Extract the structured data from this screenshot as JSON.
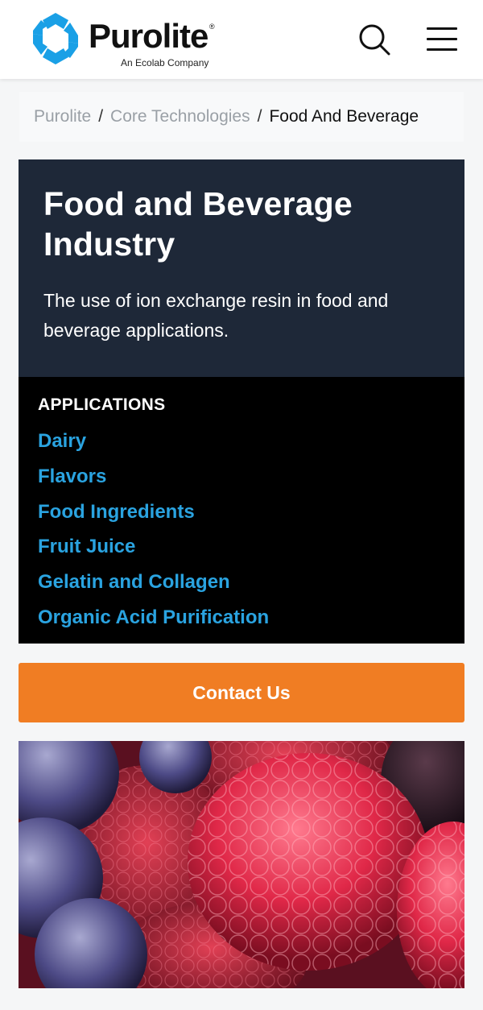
{
  "header": {
    "logo_word": "Purolite",
    "logo_reg": "®",
    "logo_tagline": "An Ecolab Company",
    "logo_color": "#1aa0e6"
  },
  "breadcrumb": {
    "items": [
      "Purolite",
      "Core Technologies"
    ],
    "separator": "/",
    "current": "Food And Beverage"
  },
  "hero": {
    "title": "Food and Beverage Industry",
    "description": "The use of ion exchange resin in food and beverage applications.",
    "background": "#1e2838"
  },
  "applications": {
    "heading": "APPLICATIONS",
    "link_color": "#2aa3e0",
    "items": [
      "Dairy",
      "Flavors",
      "Food Ingredients",
      "Fruit Juice",
      "Gelatin and Collagen",
      "Organic Acid Purification"
    ]
  },
  "contact": {
    "label": "Contact Us",
    "color": "#f07d23"
  },
  "icons": {
    "search": "search-icon",
    "menu": "hamburger-menu-icon"
  }
}
